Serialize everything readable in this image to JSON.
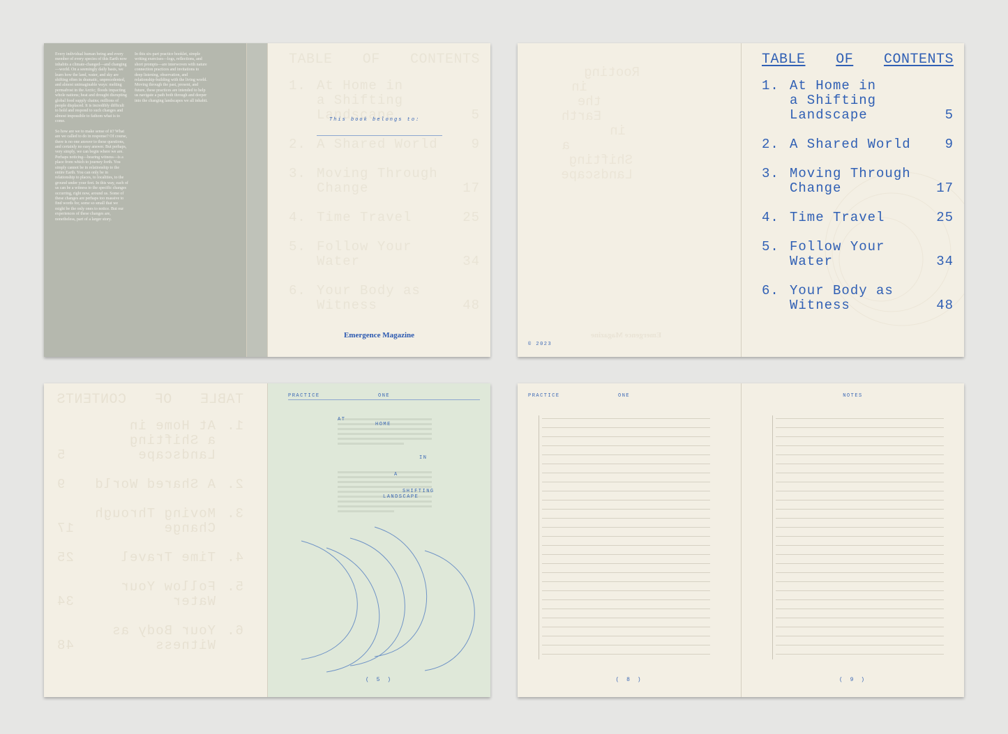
{
  "toc": {
    "title_words": [
      "TABLE",
      "OF",
      "CONTENTS"
    ],
    "items": [
      {
        "num": "1.",
        "label": "At Home in a Shifting Landscape",
        "lines": [
          "At Home in",
          "a Shifting",
          "Landscape"
        ],
        "page": "5"
      },
      {
        "num": "2.",
        "label": "A Shared World",
        "lines": [
          "A Shared World"
        ],
        "page": "9"
      },
      {
        "num": "3.",
        "label": "Moving Through Change",
        "lines": [
          "Moving Through",
          "Change"
        ],
        "page": "17"
      },
      {
        "num": "4.",
        "label": "Time Travel",
        "lines": [
          "Time Travel"
        ],
        "page": "25"
      },
      {
        "num": "5.",
        "label": "Follow Your Water",
        "lines": [
          "Follow Your",
          "Water"
        ],
        "page": "34"
      },
      {
        "num": "6.",
        "label": "Your Body as Witness",
        "lines": [
          "Your Body as",
          "Witness"
        ],
        "page": "48"
      }
    ]
  },
  "essay": {
    "col1": [
      "Every individual human being and every member of every species of this Earth now inhabits a climate-changed—and changing—world. On a seemingly daily basis, we learn how the land, water, and sky are shifting often in dramatic, unprecedented, and almost unimaginable ways: melting permafrost in the Arctic; floods impacting whole nations; heat and drought disrupting global food supply chains; millions of people displaced. It is incredibly difficult to hold and respond to such changes and almost impossible to fathom what is to come.",
      "So how are we to make sense of it? What are we called to do in response? Of course, there is no one answer to these questions, and certainly no easy answer. But perhaps, very simply, we can begin where we are. Perhaps noticing—bearing witness—is a place from which to journey forth. You simply cannot be in relationship to the entire Earth. You can only be in relationship to places, to localities, to the ground under your feet. In this way, each of us can be a witness to the specific changes occurring, right now, around us. Some of these changes are perhaps too massive to find words for, some so small that we might be the only ones to notice. But our experiences of these changes are, nonetheless, part of a larger story."
    ],
    "col2": [
      "In this six-part practice booklet, simple writing exercises—logs, reflections, and short prompts—are interwoven with nature connection practices and invitations to deep listening, observation, and relationship-building with the living world. Moving through the past, present, and future, these practices are intended to help us navigate a path both through and deeper into the changing landscapes we all inhabit."
    ]
  },
  "belongs_to": "This book belongs to:",
  "brand": "Emergence Magazine",
  "copyright": "© 2023",
  "ghost_title_lines": [
    "Rooting",
    "in",
    "the",
    "Earth",
    "in",
    "a",
    "Shifting",
    "Landscape"
  ],
  "practice": {
    "label_left": "PRACTICE",
    "label_right": "ONE",
    "title_words": [
      "AT",
      "HOME",
      "IN",
      "A",
      "SHIFTING",
      "LANDSCAPE"
    ],
    "page_num": "( 5 )"
  },
  "notes": {
    "practice_label": "PRACTICE",
    "practice_num": "ONE",
    "notes_label": "NOTES",
    "left_page": "( 8 )",
    "right_page": "( 9 )",
    "line_count": 27
  },
  "colors": {
    "background": "#e6e6e4",
    "paper": "#f3efe4",
    "sage": "#dfe8d9",
    "essay_grey": "#b5b8ae",
    "accent_blue": "#2f5fb4"
  }
}
